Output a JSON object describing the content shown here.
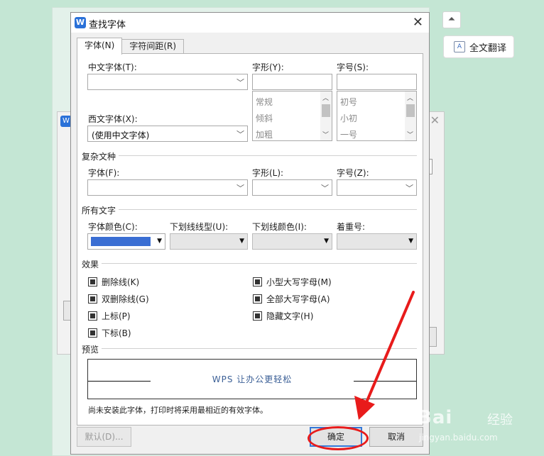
{
  "side_panel": {
    "collapse_glyph": "⏶",
    "translate_label": "全文翻译"
  },
  "dialog": {
    "title": "查找字体",
    "tabs": [
      {
        "label": "字体(N)",
        "active": true
      },
      {
        "label": "字符间距(R)",
        "active": false
      }
    ],
    "chinese_font": {
      "label": "中文字体(T):",
      "value": ""
    },
    "font_style": {
      "label": "字形(Y):",
      "value": "",
      "options": [
        "常规",
        "倾斜",
        "加粗"
      ]
    },
    "font_size": {
      "label": "字号(S):",
      "value": "",
      "options": [
        "初号",
        "小初",
        "一号"
      ]
    },
    "western_font": {
      "label": "西文字体(X):",
      "value": "(使用中文字体)"
    },
    "complex": {
      "section": "复杂文种",
      "font_label": "字体(F):",
      "style_label": "字形(L):",
      "size_label": "字号(Z):"
    },
    "all_text": {
      "section": "所有文字",
      "color_label": "字体颜色(C):",
      "color_value": "#3a6ed3",
      "underline_style_label": "下划线线型(U):",
      "underline_color_label": "下划线颜色(I):",
      "emphasis_label": "着重号:"
    },
    "effects": {
      "section": "效果",
      "left": [
        "删除线(K)",
        "双删除线(G)",
        "上标(P)",
        "下标(B)"
      ],
      "right": [
        "小型大写字母(M)",
        "全部大写字母(A)",
        "隐藏文字(H)"
      ]
    },
    "preview": {
      "section": "预览",
      "text": "WPS 让办公更轻松"
    },
    "note": "尚未安装此字体，打印时将采用最相近的有效字体。",
    "buttons": {
      "default": "默认(D)...",
      "ok": "确定",
      "cancel": "取消"
    }
  },
  "annotation_color": "#e81b1b",
  "watermark": {
    "brand": "Bai",
    "suffix": "经验",
    "url": "jingyan.baidu.com"
  }
}
